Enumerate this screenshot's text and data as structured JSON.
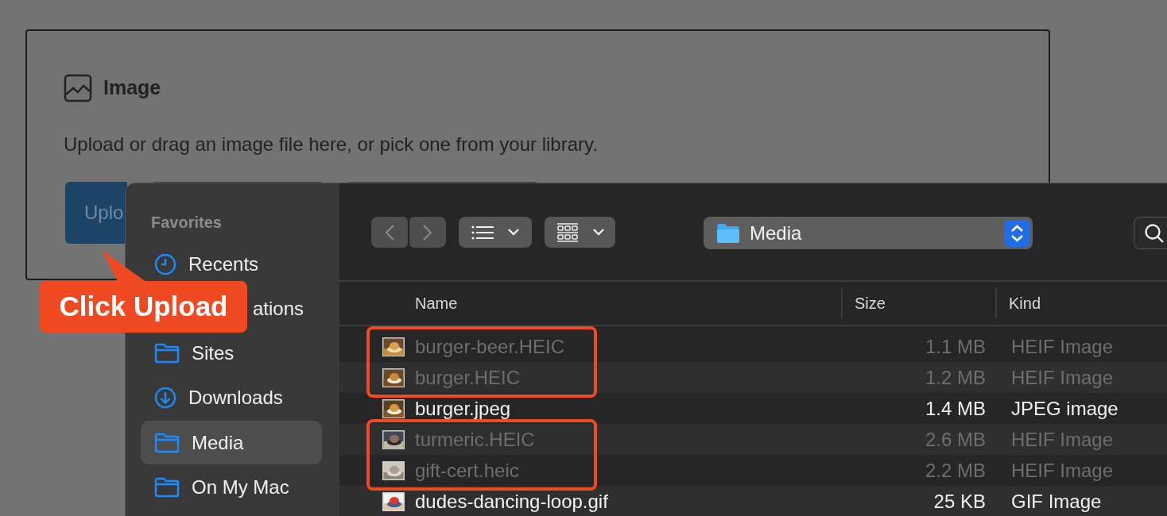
{
  "card": {
    "title": "Image",
    "description": "Upload or drag an image file here, or pick one from your library.",
    "buttons": [
      {
        "kind": "primary",
        "label": "Uplo"
      },
      {
        "kind": "outline"
      },
      {
        "kind": "outline"
      }
    ]
  },
  "dialog": {
    "sidebar": {
      "heading": "Favorites",
      "items": [
        {
          "kind": "clock",
          "label": "Recents",
          "selected": false
        },
        {
          "kind": "none",
          "label": "ations",
          "selected": false
        },
        {
          "kind": "folder",
          "label": "Sites",
          "selected": false
        },
        {
          "kind": "download",
          "label": "Downloads",
          "selected": false
        },
        {
          "kind": "folder",
          "label": "Media",
          "selected": true
        },
        {
          "kind": "folder",
          "label": "On My Mac",
          "selected": false
        }
      ]
    },
    "toolbar": {
      "location": "Media"
    },
    "file_list": {
      "columns": [
        "Name",
        "Size",
        "Kind"
      ],
      "rows": [
        {
          "name": "burger-beer.HEIC",
          "size": "1.1 MB",
          "file_kind": "HEIF Image",
          "disabled": true,
          "highlighted": true
        },
        {
          "name": "burger.HEIC",
          "size": "1.2 MB",
          "file_kind": "HEIF Image",
          "disabled": true,
          "highlighted": true
        },
        {
          "name": "burger.jpeg",
          "size": "1.4 MB",
          "file_kind": "JPEG image",
          "disabled": false,
          "highlighted": false
        },
        {
          "name": "turmeric.HEIC",
          "size": "2.6 MB",
          "file_kind": "HEIF Image",
          "disabled": true,
          "highlighted": true
        },
        {
          "name": "gift-cert.heic",
          "size": "2.2 MB",
          "file_kind": "HEIF Image",
          "disabled": true,
          "highlighted": true
        },
        {
          "name": "dudes-dancing-loop.gif",
          "size": "25 KB",
          "file_kind": "GIF Image",
          "disabled": false,
          "highlighted": false
        }
      ]
    }
  },
  "callout": {
    "text": "Click Upload"
  }
}
